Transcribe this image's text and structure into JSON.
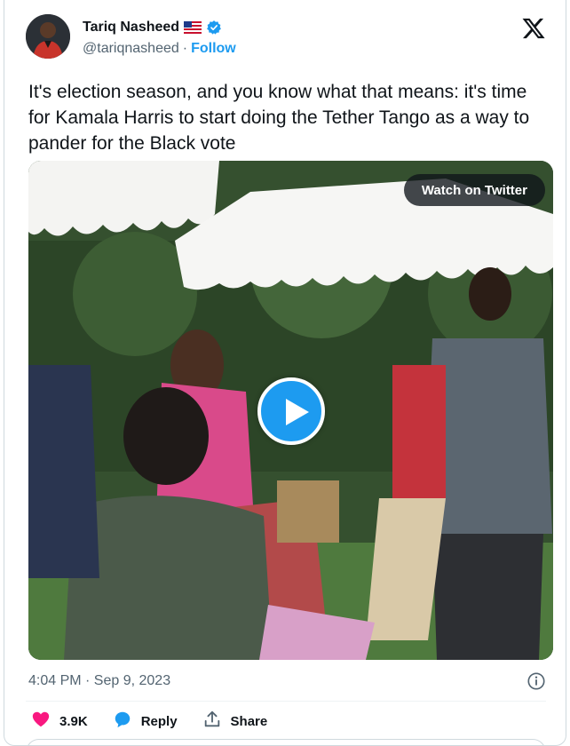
{
  "author": {
    "display_name": "Tariq Nasheed",
    "handle": "@tariqnasheed",
    "separator": "·",
    "follow_label": "Follow",
    "flag": "us-flag-emoji",
    "verified": "verified-badge-icon"
  },
  "tweet": {
    "text": "It's election season, and you know what that means: it's time for Kamala Harris to start doing the Tether Tango as a way to pander for the Black vote"
  },
  "media": {
    "watch_label": "Watch on Twitter",
    "play_icon": "play-icon"
  },
  "meta": {
    "timestamp": "4:04 PM · Sep 9, 2023",
    "info_icon": "info-icon"
  },
  "actions": {
    "like_count": "3.9K",
    "reply_label": "Reply",
    "share_label": "Share"
  },
  "colors": {
    "accent": "#1d9bf0",
    "like": "#f91880",
    "text": "#0f1419",
    "secondary": "#536471"
  }
}
